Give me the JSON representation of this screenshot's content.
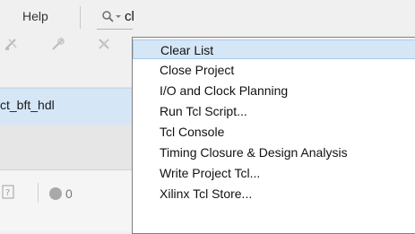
{
  "menubar": {
    "help_label": "Help"
  },
  "search": {
    "query": "cl",
    "icon": "search-icon"
  },
  "toolbar": {
    "icons": [
      "cut-icon",
      "edit-icon",
      "delete-icon"
    ]
  },
  "project": {
    "name": "ct_bft_hdl"
  },
  "status": {
    "count": "0"
  },
  "popup": {
    "items": [
      {
        "label": "Clear List",
        "selected": true
      },
      {
        "label": "Close Project"
      },
      {
        "label": "I/O and Clock Planning"
      },
      {
        "label": "Run Tcl Script..."
      },
      {
        "label": "Tcl Console"
      },
      {
        "label": "Timing Closure & Design Analysis"
      },
      {
        "label": "Write Project Tcl..."
      },
      {
        "label": "Xilinx Tcl Store..."
      }
    ]
  },
  "colors": {
    "selection": "#d5e6f7",
    "selection_border": "#a9c8ea",
    "background": "#f0f0f0"
  }
}
